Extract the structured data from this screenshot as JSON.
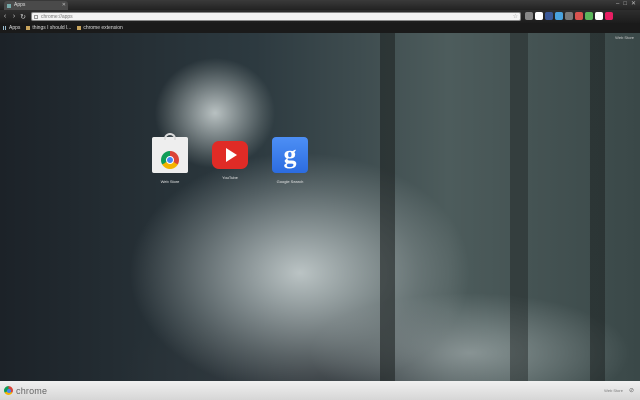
{
  "browser": {
    "tab": {
      "title": "Apps",
      "favicon": "apps-icon"
    },
    "window_controls": [
      "–",
      "□",
      "✕"
    ]
  },
  "toolbar": {
    "back_icon": "‹",
    "forward_icon": "›",
    "reload_icon": "↻",
    "url": "chrome://apps",
    "star_icon": "☆",
    "extensions": [
      "#888888",
      "#ffffff",
      "#3b5998",
      "#4aa3df",
      "#7a7a7a",
      "#d9534f",
      "#5cb85c",
      "#ffffff",
      "#e91e63"
    ]
  },
  "bookmarks": [
    {
      "label": "Apps",
      "icon": "apps-grid-icon"
    },
    {
      "label": "things I should l...",
      "icon": "folder-icon"
    },
    {
      "label": "chrome extension",
      "icon": "folder-icon"
    }
  ],
  "content": {
    "apps_link": "Web Store",
    "apps": [
      {
        "label": "Web Store",
        "icon": "chrome-web-store-icon"
      },
      {
        "label": "YouTube",
        "icon": "youtube-icon"
      },
      {
        "label": "Google Search",
        "icon": "google-search-icon",
        "glyph": "g"
      }
    ]
  },
  "bottombar": {
    "brand": "chrome",
    "right_text": "Web Store",
    "right_icon": "⊘"
  }
}
